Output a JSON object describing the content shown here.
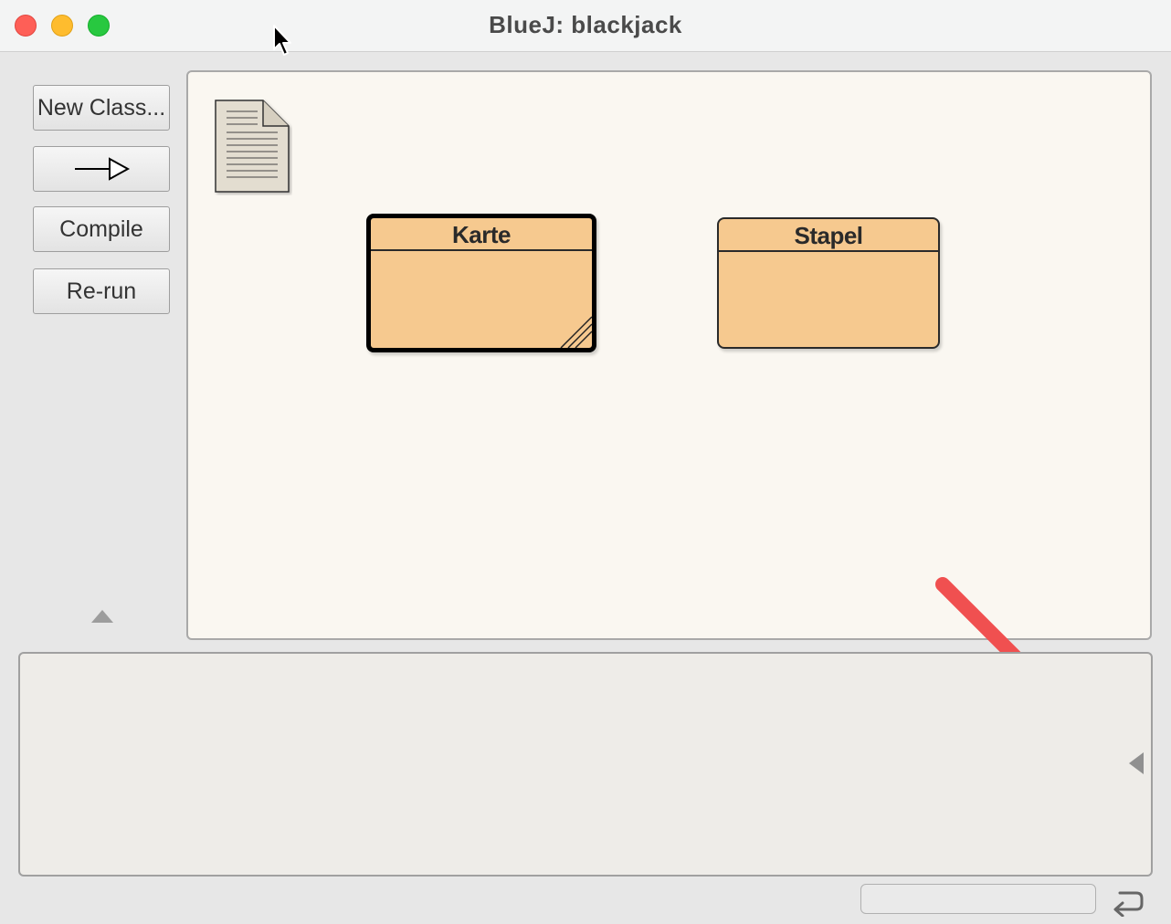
{
  "window": {
    "title": "BlueJ:  blackjack"
  },
  "toolbar": {
    "new_class_label": "New Class...",
    "arrow_tool_icon": "inheritance-arrow-icon",
    "compile_label": "Compile",
    "rerun_label": "Re-run"
  },
  "diagram": {
    "readme_icon": "readme-document-icon",
    "classes": [
      {
        "name": "Karte",
        "selected": true,
        "needs_compile": true
      },
      {
        "name": "Stapel",
        "selected": false,
        "needs_compile": false
      }
    ]
  },
  "annotation": {
    "arrow_color": "#f05050"
  },
  "status": {
    "text": ""
  },
  "colors": {
    "class_fill": "#f6c98f",
    "diagram_bg": "#faf7f1",
    "close": "#fe5f57",
    "minimize": "#febc2e",
    "maximize": "#28c840"
  }
}
